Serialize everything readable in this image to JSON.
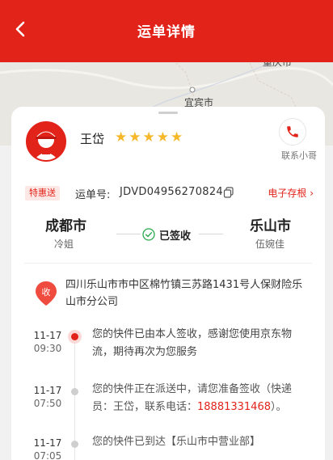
{
  "header": {
    "title": "运单详情",
    "back_icon": "chevron-left-icon"
  },
  "map": {
    "cities": [
      "重庆市",
      "宜宾市"
    ]
  },
  "courier": {
    "name": "王岱",
    "rating": 5,
    "contact_label": "联系小哥",
    "contact_icon": "phone-icon"
  },
  "waybill": {
    "badge": "特惠送",
    "label": "运单号:",
    "number": "JDVD04956270824",
    "e_receipt": "电子存根 ›"
  },
  "route": {
    "from_city": "成都市",
    "from_person": "冷姐",
    "status": "已签收",
    "to_city": "乐山市",
    "to_person": "伍婉佳"
  },
  "receiver": {
    "icon_label": "收",
    "address": "四川乐山市市中区棉竹镇三苏路1431号人保财险乐山市分公司"
  },
  "timeline": [
    {
      "date": "11-17",
      "time": "09:30",
      "text": "您的快件已由本人签收，感谢您使用京东物流，期待再次为您服务",
      "active": true
    },
    {
      "date": "11-17",
      "time": "07:50",
      "text_before": "您的快件正在派送中，请您准备签收（快递员：王岱，联系电话：",
      "phone": "18881331468",
      "text_after": "）。",
      "active": false
    },
    {
      "date": "11-17",
      "time": "07:05",
      "text": "您的快件已到达【乐山市中营业部】",
      "active": false
    }
  ],
  "colors": {
    "brand_red": "#e2231a",
    "star": "#f6b829"
  }
}
